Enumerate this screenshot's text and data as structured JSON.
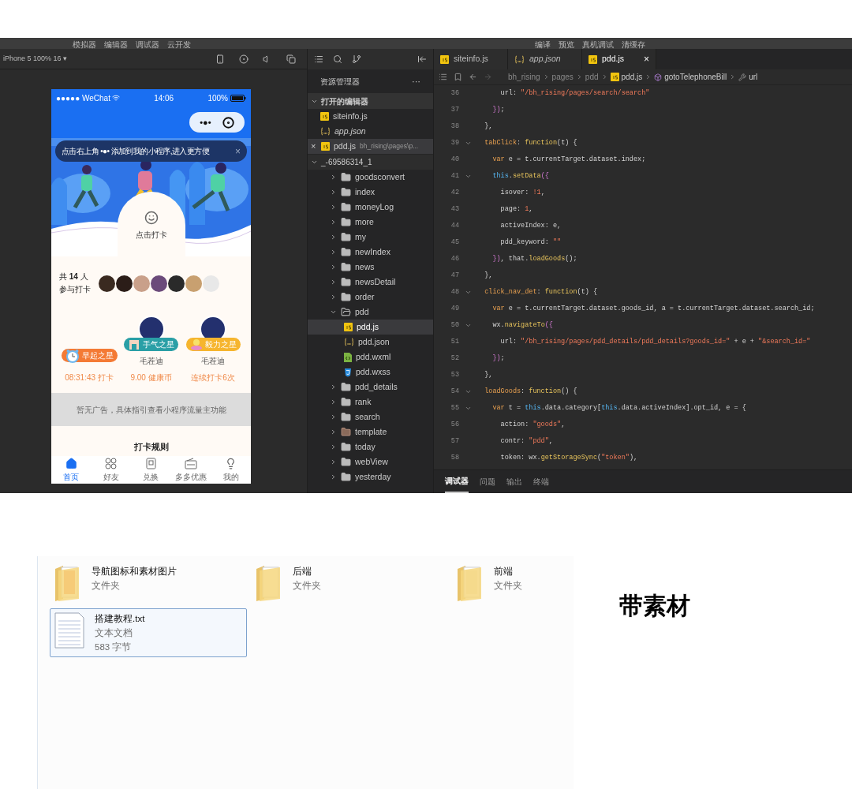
{
  "menu_left": [
    "模拟器",
    "编辑器",
    "调试器",
    "云开发"
  ],
  "menu_right": [
    "编译",
    "预览",
    "真机调试",
    "清缓存"
  ],
  "simulator": {
    "device": "iPhone 5 100% 16 ▾",
    "phone": {
      "status": {
        "carrier": "●●●●● WeChat",
        "time": "14:06",
        "battery": "100%"
      },
      "capsule": "•●•",
      "tip": {
        "text": "点击右上角 •●• 添加到我的小程序,进入更方便",
        "close": "×"
      },
      "checkin_button": "点击打卡",
      "participants": {
        "count_text": "共 **14** 人",
        "label": "参与打卡",
        "avatars": [
          {
            "kind": "photo"
          },
          {
            "kind": "photo"
          },
          {
            "kind": "photo"
          },
          {
            "kind": "photo"
          },
          {
            "kind": "photo"
          },
          {
            "kind": "photo"
          },
          {
            "kind": "more"
          }
        ]
      },
      "stars": [
        {
          "kind": "clock",
          "badge": "早起之星",
          "color": "#f47a35",
          "value": "08:31:43 打卡"
        },
        {
          "kind": "pennant",
          "badge": "手气之星",
          "color": "#2a9fa6",
          "name": "毛茬迪",
          "value": "9.00 健康币"
        },
        {
          "kind": "flower",
          "badge": "毅力之星",
          "color": "#f6b52e",
          "name": "毛茬迪",
          "value": "连续打卡6次"
        }
      ],
      "ad": "暂无广告，具体指引查看小程序流量主功能",
      "rules_title": "打卡规则",
      "tabs": [
        {
          "label": "首页",
          "selected": true
        },
        {
          "label": "好友",
          "selected": false
        },
        {
          "label": "兑换",
          "selected": false
        },
        {
          "label": "多多优惠",
          "selected": false
        },
        {
          "label": "我的",
          "selected": false
        }
      ]
    }
  },
  "explorer": {
    "title": "资源管理器",
    "more": "···",
    "open_editors": {
      "title": "打开的编辑器",
      "expanded": true,
      "files": [
        {
          "name": "siteinfo.js",
          "kind": "js",
          "preview": false,
          "selected": false
        },
        {
          "name": "app.json",
          "kind": "json",
          "preview": true,
          "selected": false
        },
        {
          "name": "pdd.js",
          "kind": "js",
          "preview": false,
          "selected": true,
          "close": "×",
          "path": "bh_rising\\pages\\p..."
        }
      ]
    },
    "project": {
      "title": "_-69586314_1",
      "expanded": true,
      "items": [
        {
          "name": "goodsconvert",
          "kind": "folder",
          "expanded": false,
          "selected": false
        },
        {
          "name": "index",
          "kind": "folder",
          "expanded": false,
          "selected": false
        },
        {
          "name": "moneyLog",
          "kind": "folder",
          "expanded": false,
          "selected": false
        },
        {
          "name": "more",
          "kind": "folder",
          "expanded": false,
          "selected": false
        },
        {
          "name": "my",
          "kind": "folder",
          "expanded": false,
          "selected": false
        },
        {
          "name": "newIndex",
          "kind": "folder",
          "expanded": false,
          "selected": false
        },
        {
          "name": "news",
          "kind": "folder",
          "expanded": false,
          "selected": false
        },
        {
          "name": "newsDetail",
          "kind": "folder",
          "expanded": false,
          "selected": false
        },
        {
          "name": "order",
          "kind": "folder",
          "expanded": false,
          "selected": false
        },
        {
          "name": "pdd",
          "kind": "folder",
          "expanded": true,
          "selected": false,
          "children": [
            {
              "name": "pdd.js",
              "kind": "js",
              "selected": true
            },
            {
              "name": "pdd.json",
              "kind": "json",
              "selected": false
            },
            {
              "name": "pdd.wxml",
              "kind": "wxml",
              "selected": false
            },
            {
              "name": "pdd.wxss",
              "kind": "wxss",
              "selected": false
            }
          ]
        },
        {
          "name": "pdd_details",
          "kind": "folder",
          "expanded": false,
          "selected": false
        },
        {
          "name": "rank",
          "kind": "folder",
          "expanded": false,
          "selected": false
        },
        {
          "name": "search",
          "kind": "folder",
          "expanded": false,
          "selected": false
        },
        {
          "name": "template",
          "kind": "special-folder",
          "expanded": false,
          "selected": false
        },
        {
          "name": "today",
          "kind": "folder",
          "expanded": false,
          "selected": false
        },
        {
          "name": "webView",
          "kind": "folder",
          "expanded": false,
          "selected": false
        },
        {
          "name": "yesterday",
          "kind": "folder",
          "expanded": false,
          "selected": false
        }
      ]
    }
  },
  "editor": {
    "tabs": [
      {
        "name": "siteinfo.js",
        "kind": "js",
        "preview": false,
        "selected": false
      },
      {
        "name": "app.json",
        "kind": "json",
        "preview": true,
        "selected": false
      },
      {
        "name": "pdd.js",
        "kind": "js",
        "preview": false,
        "selected": true,
        "close": "×"
      }
    ],
    "breadcrumb": [
      {
        "label": "bh_rising",
        "kind": "text"
      },
      {
        "label": "pages",
        "kind": "text"
      },
      {
        "label": "pdd",
        "kind": "text"
      },
      {
        "label": "pdd.js",
        "kind": "js"
      },
      {
        "label": "gotoTelephoneBill",
        "kind": "method"
      },
      {
        "label": "url",
        "kind": "property"
      }
    ],
    "lines": [
      {
        "number": "36",
        "foldable": false,
        "tokens": [
          {
            "t": "      url: ",
            "kind": "p"
          },
          {
            "t": "\"/bh_rising/pages/search/search\"",
            "kind": "str"
          }
        ]
      },
      {
        "number": "37",
        "foldable": false,
        "tokens": [
          {
            "t": "    })",
            "kind": "br"
          },
          {
            "t": ";",
            "kind": "p"
          }
        ]
      },
      {
        "number": "38",
        "foldable": false,
        "tokens": [
          {
            "t": "  },",
            "kind": "p"
          }
        ]
      },
      {
        "number": "39",
        "foldable": true,
        "tokens": [
          {
            "t": "  tabClick",
            "kind": "key"
          },
          {
            "t": ": ",
            "kind": "p"
          },
          {
            "t": "function",
            "kind": "fn"
          },
          {
            "t": "(t) {",
            "kind": "p"
          }
        ]
      },
      {
        "number": "40",
        "foldable": false,
        "tokens": [
          {
            "t": "    var",
            "kind": "kw"
          },
          {
            "t": " e = t.currentTarget.dataset.index;",
            "kind": "p"
          }
        ]
      },
      {
        "number": "41",
        "foldable": true,
        "tokens": [
          {
            "t": "    this",
            "kind": "this"
          },
          {
            "t": ".",
            "kind": "p"
          },
          {
            "t": "setData",
            "kind": "fn"
          },
          {
            "t": "({",
            "kind": "br"
          }
        ]
      },
      {
        "number": "42",
        "foldable": false,
        "tokens": [
          {
            "t": "      isover: ",
            "kind": "p"
          },
          {
            "t": "!1",
            "kind": "num"
          },
          {
            "t": ",",
            "kind": "p"
          }
        ]
      },
      {
        "number": "43",
        "foldable": false,
        "tokens": [
          {
            "t": "      page: ",
            "kind": "p"
          },
          {
            "t": "1",
            "kind": "num"
          },
          {
            "t": ",",
            "kind": "p"
          }
        ]
      },
      {
        "number": "44",
        "foldable": false,
        "tokens": [
          {
            "t": "      activeIndex: e,",
            "kind": "p"
          }
        ]
      },
      {
        "number": "45",
        "foldable": false,
        "tokens": [
          {
            "t": "      pdd_keyword: ",
            "kind": "p"
          },
          {
            "t": "\"\"",
            "kind": "str"
          }
        ]
      },
      {
        "number": "46",
        "foldable": false,
        "tokens": [
          {
            "t": "    })",
            "kind": "br"
          },
          {
            "t": ", that.",
            "kind": "p"
          },
          {
            "t": "loadGoods",
            "kind": "fn"
          },
          {
            "t": "();",
            "kind": "p"
          }
        ]
      },
      {
        "number": "47",
        "foldable": false,
        "tokens": [
          {
            "t": "  },",
            "kind": "p"
          }
        ]
      },
      {
        "number": "48",
        "foldable": true,
        "tokens": [
          {
            "t": "  click_nav_det",
            "kind": "key"
          },
          {
            "t": ": ",
            "kind": "p"
          },
          {
            "t": "function",
            "kind": "fn"
          },
          {
            "t": "(t) {",
            "kind": "p"
          }
        ]
      },
      {
        "number": "49",
        "foldable": false,
        "tokens": [
          {
            "t": "    var",
            "kind": "kw"
          },
          {
            "t": " e = t.currentTarget.dataset.goods_id, a = t.currentTarget.dataset.search_id;",
            "kind": "p"
          }
        ]
      },
      {
        "number": "50",
        "foldable": true,
        "tokens": [
          {
            "t": "    wx.",
            "kind": "p"
          },
          {
            "t": "navigateTo",
            "kind": "fn"
          },
          {
            "t": "({",
            "kind": "br"
          }
        ]
      },
      {
        "number": "51",
        "foldable": false,
        "tokens": [
          {
            "t": "      url: ",
            "kind": "p"
          },
          {
            "t": "\"/bh_rising/pages/pdd_details/pdd_details?goods_id=\"",
            "kind": "str"
          },
          {
            "t": " + e + ",
            "kind": "p"
          },
          {
            "t": "\"&search_id=\"",
            "kind": "str"
          }
        ]
      },
      {
        "number": "52",
        "foldable": false,
        "tokens": [
          {
            "t": "    })",
            "kind": "br"
          },
          {
            "t": ";",
            "kind": "p"
          }
        ]
      },
      {
        "number": "53",
        "foldable": false,
        "tokens": [
          {
            "t": "  },",
            "kind": "p"
          }
        ]
      },
      {
        "number": "54",
        "foldable": true,
        "tokens": [
          {
            "t": "  loadGoods",
            "kind": "key"
          },
          {
            "t": ": ",
            "kind": "p"
          },
          {
            "t": "function",
            "kind": "fn"
          },
          {
            "t": "() {",
            "kind": "p"
          }
        ]
      },
      {
        "number": "55",
        "foldable": true,
        "tokens": [
          {
            "t": "    var",
            "kind": "kw"
          },
          {
            "t": " t = ",
            "kind": "p"
          },
          {
            "t": "this",
            "kind": "this"
          },
          {
            "t": ".data.category[",
            "kind": "p"
          },
          {
            "t": "this",
            "kind": "this"
          },
          {
            "t": ".data.activeIndex].opt_id, e = {",
            "kind": "p"
          }
        ]
      },
      {
        "number": "56",
        "foldable": false,
        "tokens": [
          {
            "t": "      action: ",
            "kind": "p"
          },
          {
            "t": "\"goods\"",
            "kind": "str"
          },
          {
            "t": ",",
            "kind": "p"
          }
        ]
      },
      {
        "number": "57",
        "foldable": false,
        "tokens": [
          {
            "t": "      contr: ",
            "kind": "p"
          },
          {
            "t": "\"pdd\"",
            "kind": "str"
          },
          {
            "t": ",",
            "kind": "p"
          }
        ]
      },
      {
        "number": "58",
        "foldable": false,
        "tokens": [
          {
            "t": "      token: wx.",
            "kind": "p"
          },
          {
            "t": "getStorageSync",
            "kind": "fn"
          },
          {
            "t": "(",
            "kind": "p"
          },
          {
            "t": "\"token\"",
            "kind": "str"
          },
          {
            "t": "),",
            "kind": "p"
          }
        ]
      }
    ],
    "panel_tabs": [
      {
        "label": "调试器",
        "selected": true
      },
      {
        "label": "问题",
        "selected": false
      },
      {
        "label": "输出",
        "selected": false
      },
      {
        "label": "终端",
        "selected": false
      }
    ]
  },
  "desktop": {
    "files": [
      {
        "name": "导航图标和素材图片",
        "type": "文件夹",
        "kind": "folder",
        "selected": false
      },
      {
        "name": "后端",
        "type": "文件夹",
        "kind": "folder",
        "selected": false
      },
      {
        "name": "前端",
        "type": "文件夹",
        "kind": "folder",
        "selected": false
      },
      {
        "name": "搭建教程.txt",
        "type": "文本文档",
        "size": "583 字节",
        "kind": "text",
        "selected": true
      }
    ],
    "caption": "带素材"
  }
}
